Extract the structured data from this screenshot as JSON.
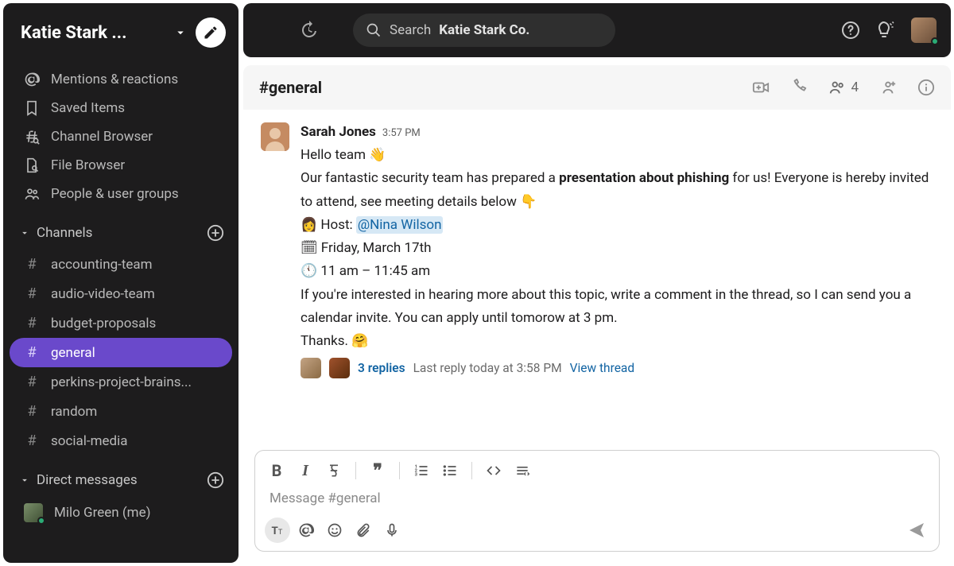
{
  "workspace": {
    "name": "Katie Stark ..."
  },
  "navItems": [
    {
      "id": "mentions",
      "label": "Mentions & reactions",
      "icon": "at"
    },
    {
      "id": "saved",
      "label": "Saved Items",
      "icon": "bookmark"
    },
    {
      "id": "channel-browser",
      "label": "Channel Browser",
      "icon": "compass"
    },
    {
      "id": "file-browser",
      "label": "File Browser",
      "icon": "file"
    },
    {
      "id": "people",
      "label": "People & user groups",
      "icon": "people"
    }
  ],
  "channelsSection": {
    "title": "Channels"
  },
  "channels": [
    {
      "name": "accounting-team",
      "active": false
    },
    {
      "name": "audio-video-team",
      "active": false
    },
    {
      "name": "budget-proposals",
      "active": false
    },
    {
      "name": "general",
      "active": true
    },
    {
      "name": "perkins-project-brains...",
      "active": false
    },
    {
      "name": "random",
      "active": false
    },
    {
      "name": "social-media",
      "active": false
    }
  ],
  "dmSection": {
    "title": "Direct messages"
  },
  "dms": [
    {
      "name": "Milo Green (me)",
      "online": true
    }
  ],
  "search": {
    "prefix": "Search",
    "context": "Katie Stark Co."
  },
  "channelHeader": {
    "name": "#general",
    "memberCount": "4"
  },
  "message": {
    "author": "Sarah Jones",
    "time": "3:57 PM",
    "line1a": "Hello team ",
    "emoji_wave": "👋",
    "line2a": "Our fantastic security team has prepared a ",
    "line2b_strong": "presentation about phishing",
    "line2c": " for us! Everyone is hereby invited to attend, see meeting details below  ",
    "emoji_pointdown": "👇",
    "hostLinePrefix": "👩 Host: ",
    "hostMention": "@Nina Wilson",
    "dateLine": "🗓 Friday, March 17th",
    "timeLine": "🕚 11 am – 11:45 am",
    "line3": "If you're interested in hearing more about this topic, write a comment in the thread, so I can send you a calendar invite. You can apply until tomorow at 3 pm.",
    "line4a": "Thanks. ",
    "emoji_hug": "🤗"
  },
  "thread": {
    "replies": "3 replies",
    "lastReply": "Last reply today at 3:58 PM",
    "view": "View thread"
  },
  "composer": {
    "placeholder": "Message #general"
  }
}
